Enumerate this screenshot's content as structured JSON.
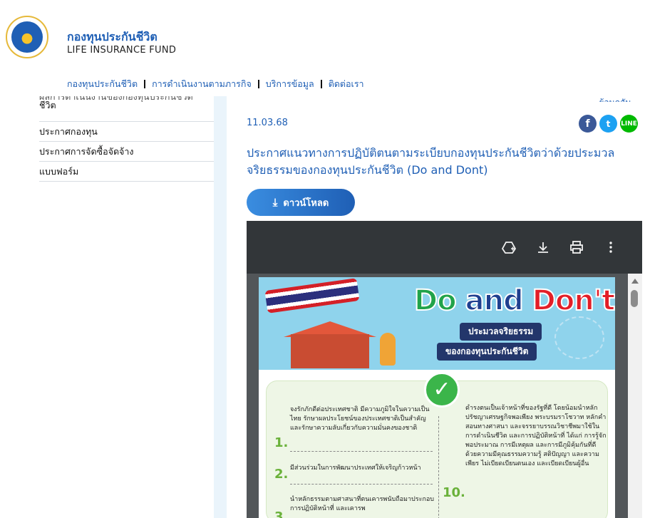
{
  "brand": {
    "name_th": "กองทุนประกันชีวิต",
    "name_en": "LIFE INSURANCE FUND",
    "logo_icon": "life-insurance-fund-seal"
  },
  "topnav": {
    "items": [
      "กองทุนประกันชีวิต",
      "การดำเนินงานตามภารกิจ",
      "บริการข้อมูล",
      "ติดต่อเรา"
    ]
  },
  "sidebar": {
    "cut_item": "ผลการดำเนินงานของกองทุนประกันชีวิต",
    "items": [
      "ชีวิต",
      "ประกาศกองทุน",
      "ประกาศการจัดซื้อจัดจ้าง",
      "แบบฟอร์ม"
    ]
  },
  "main": {
    "back_label": "ย้อนกลับ",
    "date": "11.03.68",
    "title": "ประกาศแนวทางการปฏิบัติตนตามระเบียบกองทุนประกันชีวิตว่าด้วยประมวลจริยธรรมของกองทุนประกันชีวิต (Do and Dont)",
    "download_label": "ดาวน์โหลด",
    "share": {
      "facebook": "f",
      "twitter": "t",
      "line": "LINE"
    }
  },
  "viewer": {
    "icons": [
      "drive-add-icon",
      "download-icon",
      "print-icon",
      "more-vert-icon"
    ],
    "poster": {
      "title_do": "Do",
      "title_and": "and",
      "title_dont": "Don't",
      "subtitle_1": "ประมวลจริยธรรม",
      "subtitle_2": "ของกองทุนประกันชีวิต",
      "left": [
        {
          "num": "1.",
          "text": "จงรักภักดีต่อประเทศชาติ มีความภูมิใจในความเป็นไทย รักษาผลประโยชน์ของประเทศชาติเป็นสำคัญและรักษาความลับเกี่ยวกับความมั่นคงของชาติ"
        },
        {
          "num": "2.",
          "text": "มีส่วนร่วมในการพัฒนาประเทศให้เจริญก้าวหน้า"
        },
        {
          "num": "3.",
          "text": "นำหลักธรรมตามศาสนาที่ตนเคารพนับถือมาประกอบการปฏิบัติหน้าที่ และเคารพ"
        }
      ],
      "right": [
        {
          "num": "10.",
          "text": "ดำรงตนเป็นเจ้าหน้าที่ของรัฐที่ดี โดยน้อมนำหลักปรัชญาเศรษฐกิจพอเพียง พระบรมราโชวาท หลักคำสอนทางศาสนา และจรรยาบรรณวิชาชีพมาใช้ในการดำเนินชีวิต และการปฏิบัติหน้าที่ ได้แก่ การรู้จักพอประมาณ การมีเหตุผล และการมีภูมิคุ้มกันที่ดี ด้วยความมีคุณธรรมความรู้ สติปัญญา และความเพียร ไม่เบียดเบียนตนเอง และเบียดเบียนผู้อื่น"
        }
      ]
    }
  }
}
